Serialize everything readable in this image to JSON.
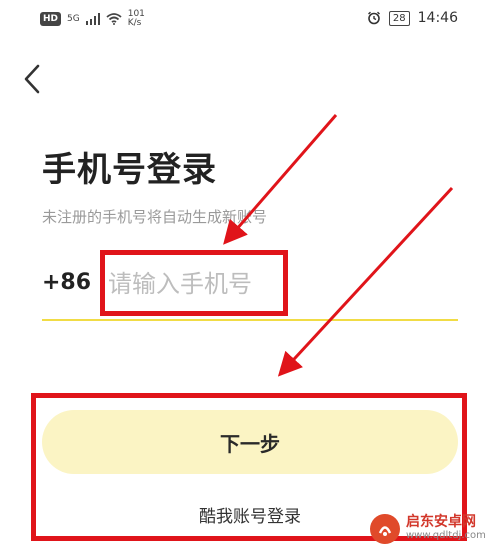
{
  "status_bar": {
    "network_badge": "HD",
    "signal_type": "5G",
    "speed_value": "101",
    "speed_unit": "K/s",
    "battery": "28",
    "time": "14:46"
  },
  "login": {
    "title": "手机号登录",
    "subtitle": "未注册的手机号将自动生成新账号",
    "country_code": "+86",
    "phone_placeholder": "请输入手机号",
    "phone_value": "",
    "next_label": "下一步",
    "alt_login_label": "酷我账号登录"
  },
  "watermark": {
    "name": "启东安卓网",
    "url": "www.qdltdj.com"
  },
  "colors": {
    "accent_yellow": "#f1dc45",
    "button_bg": "#fbf4c4",
    "annotation_red": "#e0141a"
  }
}
